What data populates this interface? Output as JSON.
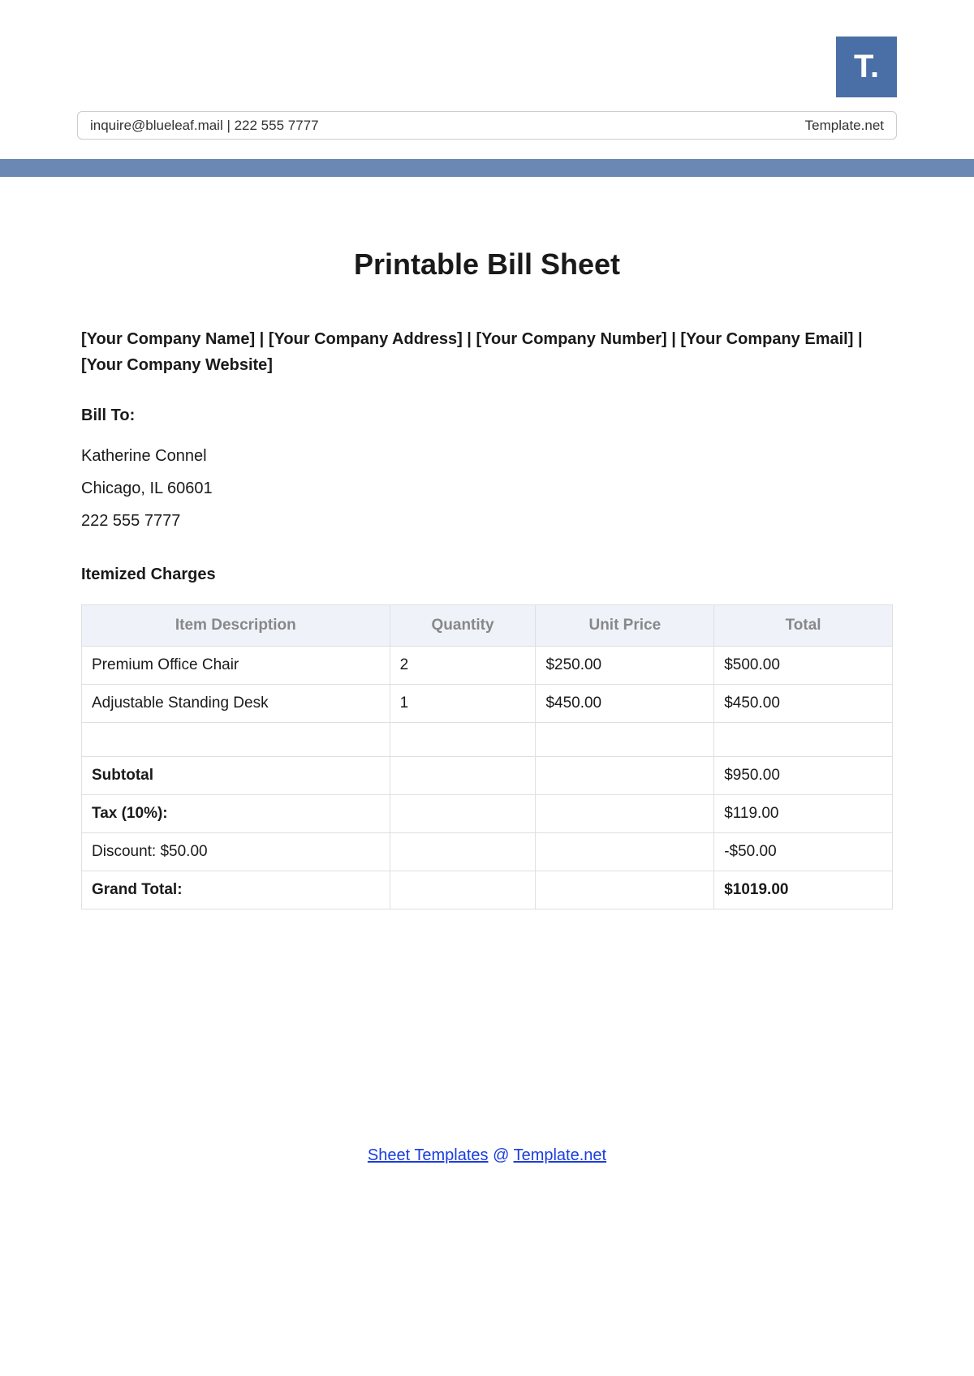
{
  "logo": "T.",
  "header": {
    "left": "inquire@blueleaf.mail  |  222 555 7777",
    "right": "Template.net"
  },
  "title": "Printable Bill Sheet",
  "company_fields": {
    "name": "[Your Company Name]",
    "address": "[Your Company Address]",
    "number": "[Your Company Number]",
    "email": "[Your Company Email]",
    "website": "[Your Company Website]"
  },
  "bill_to": {
    "label": "Bill To:",
    "name": "Katherine Connel",
    "address": "Chicago, IL 60601",
    "phone": "222 555 7777"
  },
  "section_title": "Itemized Charges",
  "table": {
    "headers": {
      "description": "Item Description",
      "quantity": "Quantity",
      "unit_price": "Unit Price",
      "total": "Total"
    },
    "rows": [
      {
        "description": "Premium Office Chair",
        "quantity": "2",
        "unit_price": "$250.00",
        "total": "$500.00"
      },
      {
        "description": "Adjustable Standing Desk",
        "quantity": "1",
        "unit_price": "$450.00",
        "total": "$450.00"
      }
    ],
    "summary": {
      "subtotal_label": "Subtotal",
      "subtotal_value": "$950.00",
      "tax_label": "Tax (10%):",
      "tax_value": "$119.00",
      "discount_label_prefix": "Discount:",
      "discount_label_value": "$50.00",
      "discount_value": "-$50.00",
      "grand_total_label": "Grand Total:",
      "grand_total_value": "$1019.00"
    }
  },
  "footer": {
    "link1": "Sheet Templates",
    "at": " @ ",
    "link2": "Template.net"
  }
}
